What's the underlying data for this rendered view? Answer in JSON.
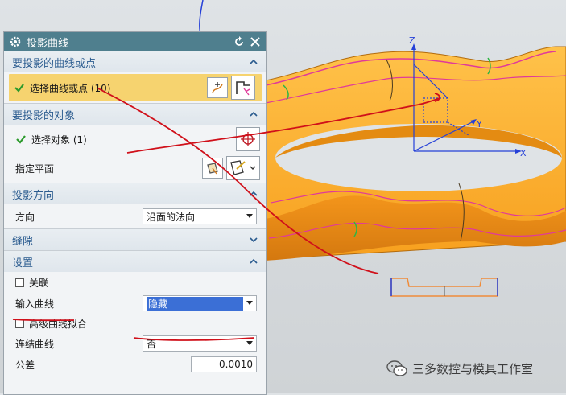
{
  "dialog": {
    "title": "投影曲线",
    "sections": {
      "curves": {
        "header": "要投影的曲线或点",
        "select_label": "选择曲线或点 (10)"
      },
      "object": {
        "header": "要投影的对象",
        "select_label": "选择对象 (1)",
        "plane_label": "指定平面"
      },
      "direction": {
        "header": "投影方向",
        "dir_label": "方向",
        "dir_value": "沿面的法向"
      },
      "gap": {
        "header": "缝隙"
      },
      "settings": {
        "header": "设置",
        "associative_label": "关联",
        "input_curves_label": "输入曲线",
        "input_curves_value": "隐藏",
        "advanced_fit_label": "高级曲线拟合",
        "join_curves_label": "连结曲线",
        "join_curves_value": "否",
        "tolerance_label": "公差",
        "tolerance_value": "0.0010"
      }
    }
  },
  "viewport": {
    "axis_x": "X",
    "axis_y": "Y",
    "axis_z": "Z"
  },
  "watermark": "三多数控与模具工作室",
  "colors": {
    "title_bar": "#4f7f8e",
    "header_text": "#2a5b8f",
    "highlight": "#f6d36f",
    "part_orange": "#f5a623",
    "annotation_red": "#d0101a",
    "projected_curve": "#e0399a"
  }
}
